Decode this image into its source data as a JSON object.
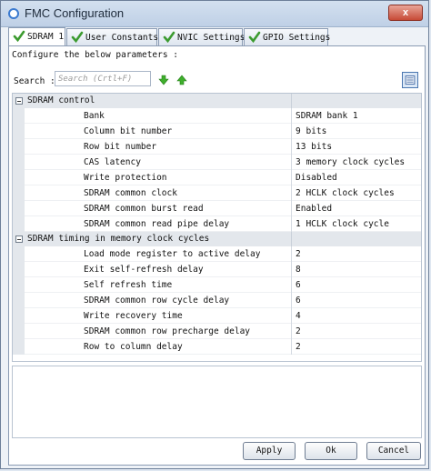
{
  "window": {
    "title": "FMC Configuration",
    "close_label": "x"
  },
  "tabs": [
    {
      "label": "SDRAM 1"
    },
    {
      "label": "User Constants"
    },
    {
      "label": "NVIC Settings"
    },
    {
      "label": "GPIO Settings"
    }
  ],
  "configure_label": "Configure the below parameters :",
  "search": {
    "label": "Search :",
    "placeholder": "Search (Crtl+F)"
  },
  "categories": [
    {
      "label": "SDRAM control",
      "params": [
        {
          "name": "Bank",
          "value": "SDRAM bank 1"
        },
        {
          "name": "Column bit number",
          "value": "9 bits"
        },
        {
          "name": "Row bit number",
          "value": "13 bits"
        },
        {
          "name": "CAS latency",
          "value": "3 memory clock cycles"
        },
        {
          "name": "Write protection",
          "value": "Disabled"
        },
        {
          "name": "SDRAM common clock",
          "value": "2 HCLK clock cycles"
        },
        {
          "name": "SDRAM common burst read",
          "value": "Enabled"
        },
        {
          "name": "SDRAM common read pipe delay",
          "value": "1 HCLK clock cycle"
        }
      ]
    },
    {
      "label": "SDRAM timing in memory clock cycles",
      "params": [
        {
          "name": "Load mode register to active delay",
          "value": "2"
        },
        {
          "name": "Exit self-refresh delay",
          "value": "8"
        },
        {
          "name": "Self refresh time",
          "value": "6"
        },
        {
          "name": "SDRAM common row cycle delay",
          "value": "6"
        },
        {
          "name": "Write recovery time",
          "value": "4"
        },
        {
          "name": "SDRAM common row precharge delay",
          "value": "2"
        },
        {
          "name": "Row to column delay",
          "value": "2"
        }
      ]
    }
  ],
  "buttons": {
    "apply": "Apply",
    "ok": "Ok",
    "cancel": "Cancel"
  },
  "colors": {
    "accent": "#3c9b2f",
    "titlebar": "#c7d6ea"
  }
}
